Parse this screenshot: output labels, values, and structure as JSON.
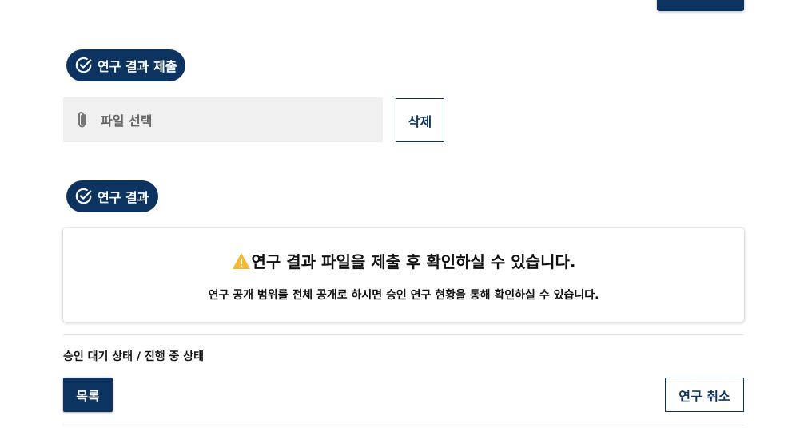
{
  "colors": {
    "primary": "#0d3461",
    "warning": "#f5b82e",
    "file_box_bg": "#f0f0f0"
  },
  "submit_section": {
    "title": "연구 결과 제출",
    "icon": "check-circle-icon"
  },
  "file_input": {
    "placeholder": "파일 선택",
    "icon": "paperclip-icon"
  },
  "delete_button": {
    "label": "삭제"
  },
  "result_section": {
    "title": "연구 결과",
    "icon": "check-circle-icon"
  },
  "notice": {
    "icon": "warning-icon",
    "title": "연구 결과 파일을 제출 후 확인하실 수 있습니다.",
    "subtitle": "연구 공개 범위를 전체 공개로 하시면 승인 연구 현황을 통해 확인하실 수 있습니다."
  },
  "status": {
    "text": "승인 대기 상태 / 진행 중 상태"
  },
  "footer": {
    "list_button": "목록",
    "cancel_button": "연구 취소"
  }
}
